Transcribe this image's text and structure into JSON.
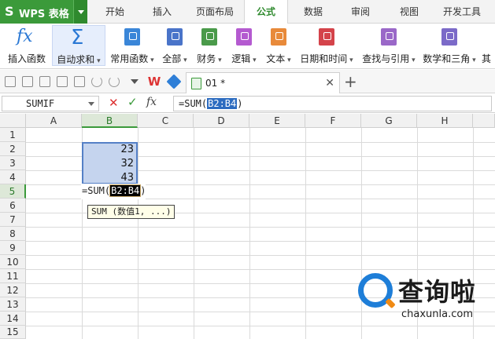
{
  "app": {
    "name": "WPS 表格"
  },
  "menu": {
    "tabs": [
      {
        "label": "开始"
      },
      {
        "label": "插入"
      },
      {
        "label": "页面布局"
      },
      {
        "label": "公式",
        "active": true
      },
      {
        "label": "数据"
      },
      {
        "label": "审阅"
      },
      {
        "label": "视图"
      },
      {
        "label": "开发工具"
      }
    ]
  },
  "ribbon": {
    "items": [
      {
        "label": "插入函数",
        "icon": "fx-icon"
      },
      {
        "label": "自动求和",
        "icon": "sigma-icon",
        "dropdown": true,
        "selected": true
      },
      {
        "label": "常用函数",
        "icon": "star-book-icon",
        "dropdown": true,
        "color": "#3a86d8"
      },
      {
        "label": "全部",
        "icon": "list-book-icon",
        "dropdown": true,
        "color": "#4a74c9"
      },
      {
        "label": "财务",
        "icon": "finance-book-icon",
        "dropdown": true,
        "color": "#4a9a4a"
      },
      {
        "label": "逻辑",
        "icon": "question-book-icon",
        "dropdown": true,
        "color": "#b45ad0"
      },
      {
        "label": "文本",
        "icon": "text-book-icon",
        "dropdown": true,
        "color": "#e88a3a"
      },
      {
        "label": "日期和时间",
        "icon": "clock-book-icon",
        "dropdown": true,
        "color": "#d4434a"
      },
      {
        "label": "查找与引用",
        "icon": "search-book-icon",
        "dropdown": true,
        "color": "#9a68c8"
      },
      {
        "label": "数学和三角",
        "icon": "theta-book-icon",
        "dropdown": true,
        "color": "#7b6ac8"
      },
      {
        "label": "其",
        "icon": "",
        "dropdown": false
      }
    ]
  },
  "document": {
    "tab_name": "01 *"
  },
  "formula_bar": {
    "name_box": "SUMIF",
    "formula_prefix": "=SUM(",
    "formula_ref": "B2:B4",
    "formula_suffix": ")"
  },
  "sheet": {
    "columns": [
      "A",
      "B",
      "C",
      "D",
      "E",
      "F",
      "G",
      "H"
    ],
    "active_column": "B",
    "rows": [
      "1",
      "2",
      "3",
      "4",
      "5",
      "6",
      "7",
      "8",
      "9",
      "10",
      "11",
      "12",
      "13",
      "14",
      "15"
    ],
    "active_row": "5",
    "cells": [
      {
        "ref": "B2",
        "value": "23"
      },
      {
        "ref": "B3",
        "value": "32"
      },
      {
        "ref": "B4",
        "value": "43"
      }
    ],
    "editing": {
      "prefix": "=SUM(",
      "ref": "B2:B4",
      "suffix": ")"
    },
    "tooltip": "SUM (数值1, ...)"
  },
  "watermark": {
    "title": "查询啦",
    "url": "chaxunla.com"
  },
  "colors": {
    "brand": "#3b9a3a",
    "selection": "#c5d4ee",
    "accent": "#1e7ed8"
  }
}
